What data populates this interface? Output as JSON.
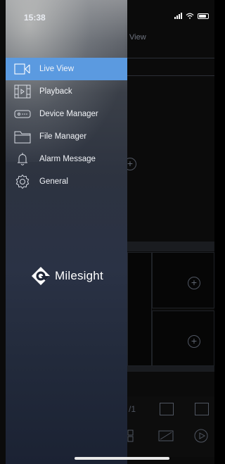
{
  "status_bar": {
    "time": "15:38"
  },
  "background_app": {
    "title": "View",
    "toolbar": {
      "page_indicator": "/1"
    }
  },
  "drawer": {
    "menu": [
      {
        "label": "Live View",
        "icon": "live-view-icon",
        "active": true
      },
      {
        "label": "Playback",
        "icon": "playback-icon",
        "active": false
      },
      {
        "label": "Device Manager",
        "icon": "device-manager-icon",
        "active": false
      },
      {
        "label": "File Manager",
        "icon": "folder-icon",
        "active": false
      },
      {
        "label": "Alarm Message",
        "icon": "bell-icon",
        "active": false
      },
      {
        "label": "General",
        "icon": "gear-icon",
        "active": false
      }
    ],
    "logo": {
      "text": "Milesight"
    }
  },
  "colors": {
    "active_item": "#5b9ae0",
    "drawer_bottom": "#1b2233"
  }
}
